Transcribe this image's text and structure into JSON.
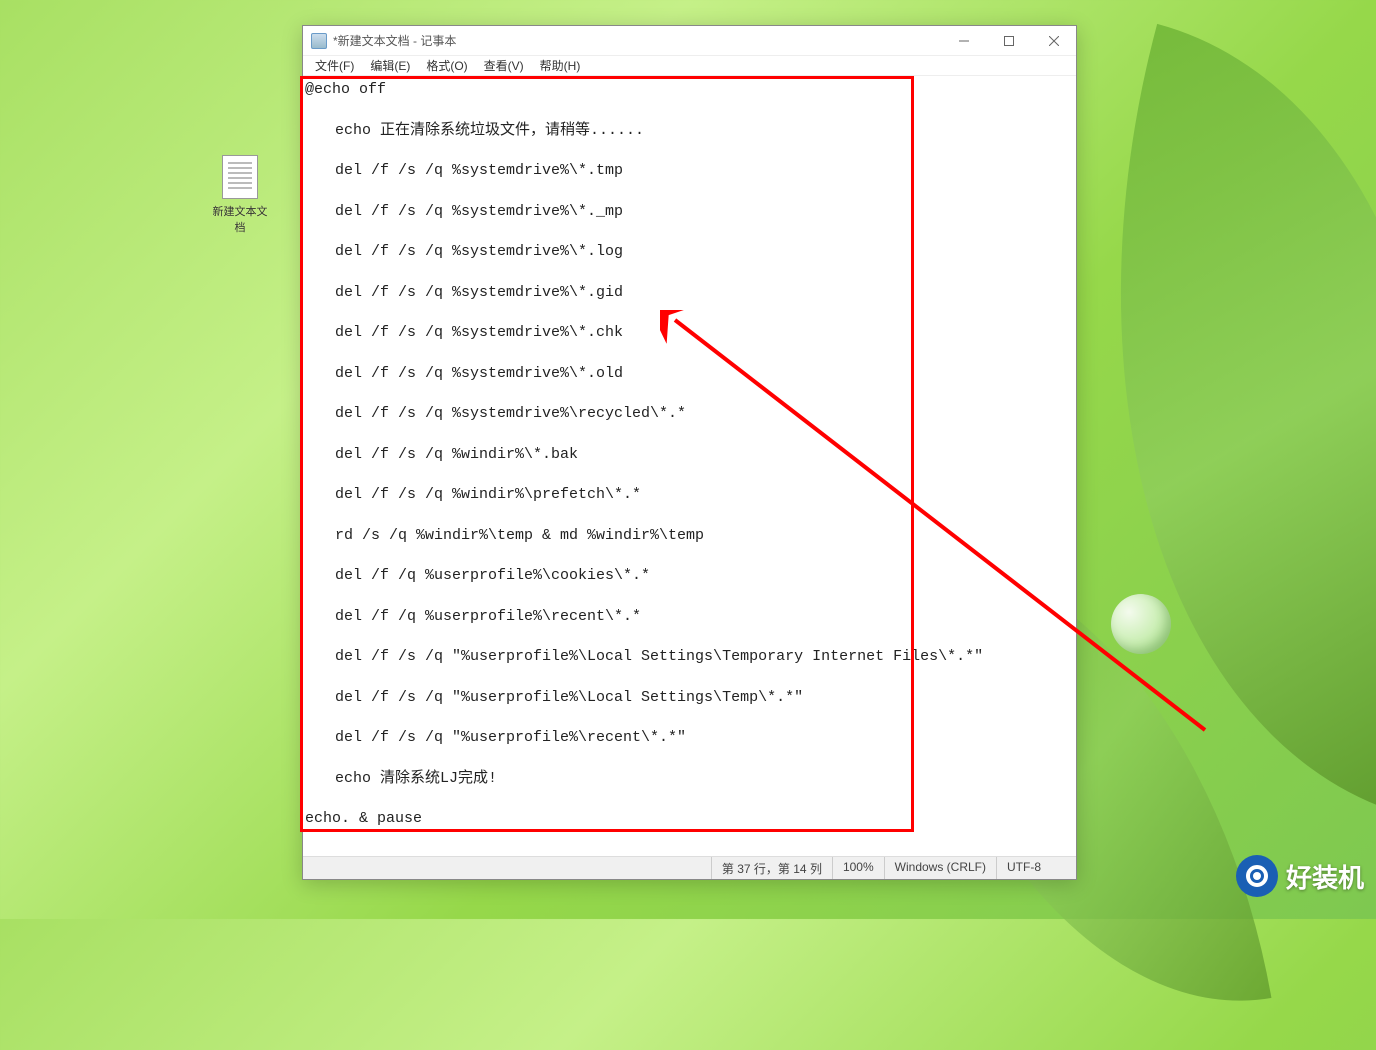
{
  "desktop": {
    "icon_label": "新建文本文档"
  },
  "window": {
    "title": "*新建文本文档 - 记事本",
    "menus": {
      "file": "文件(F)",
      "edit": "编辑(E)",
      "format": "格式(O)",
      "view": "查看(V)",
      "help": "帮助(H)"
    },
    "content": "@echo off\n\n　　echo 正在清除系统垃圾文件，请稍等......\n\n　　del /f /s /q %systemdrive%\\*.tmp\n\n　　del /f /s /q %systemdrive%\\*._mp\n\n　　del /f /s /q %systemdrive%\\*.log\n\n　　del /f /s /q %systemdrive%\\*.gid\n\n　　del /f /s /q %systemdrive%\\*.chk\n\n　　del /f /s /q %systemdrive%\\*.old\n\n　　del /f /s /q %systemdrive%\\recycled\\*.*\n\n　　del /f /s /q %windir%\\*.bak\n\n　　del /f /s /q %windir%\\prefetch\\*.*\n\n　　rd /s /q %windir%\\temp & md %windir%\\temp\n\n　　del /f /q %userprofile%\\cookies\\*.*\n\n　　del /f /q %userprofile%\\recent\\*.*\n\n　　del /f /s /q \"%userprofile%\\Local Settings\\Temporary Internet Files\\*.*\"\n\n　　del /f /s /q \"%userprofile%\\Local Settings\\Temp\\*.*\"\n\n　　del /f /s /q \"%userprofile%\\recent\\*.*\"\n\n　　echo 清除系统LJ完成!\n\necho. & pause",
    "statusbar": {
      "position": "第 37 行，第 14 列",
      "zoom": "100%",
      "line_ending": "Windows (CRLF)",
      "encoding": "UTF-8"
    }
  },
  "watermark": {
    "text": "好装机"
  }
}
